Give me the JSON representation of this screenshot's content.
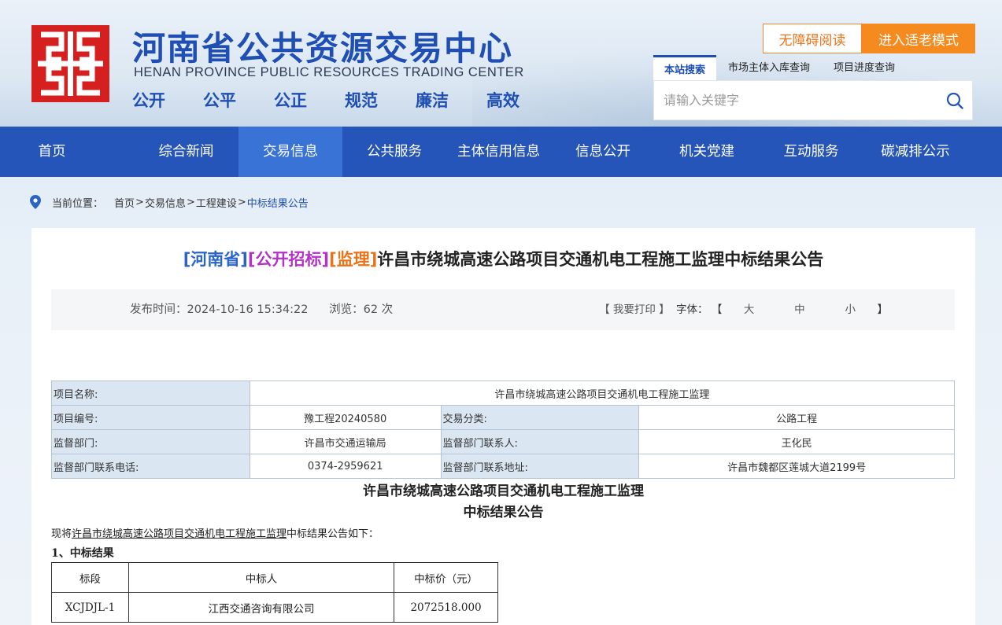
{
  "header": {
    "title_cn": "河南省公共资源交易中心",
    "title_en": "HENAN PROVINCE PUBLIC RESOURCES TRADING CENTER",
    "slogans": [
      "公开",
      "公平",
      "公正",
      "规范",
      "廉洁",
      "高效"
    ],
    "accessibility_label": "无障碍阅读",
    "elder_mode_label": "进入适老模式",
    "search_tabs": [
      "本站搜索",
      "市场主体入库查询",
      "项目进度查询"
    ],
    "search_placeholder": "请输入关键字",
    "brand_color": "#2555b8",
    "accent_color": "#f58a1f"
  },
  "nav": {
    "items": [
      "首页",
      "综合新闻",
      "交易信息",
      "公共服务",
      "主体信用信息",
      "信息公开",
      "机关党建",
      "互动服务",
      "碳减排公示"
    ],
    "active_index": 2
  },
  "breadcrumb": {
    "label": "当前位置：",
    "items": [
      "首页",
      "交易信息",
      "工程建设",
      "中标结果公告"
    ],
    "separator": ">"
  },
  "article": {
    "tag_region": "[河南省]",
    "tag_method": "[公开招标]",
    "tag_type": "[监理]",
    "title": "许昌市绕城高速公路项目交通机电工程施工监理中标结果公告",
    "publish_label": "发布时间：",
    "publish_time": "2024-10-16 15:34:22",
    "views_label": "浏览：",
    "views": "62 次",
    "print_label": "【 我要打印 】",
    "font_label": "字体：",
    "bracket_open": "【",
    "bracket_close": "】",
    "font_sizes": [
      "大",
      "中",
      "小"
    ]
  },
  "info_table": {
    "project_name_label": "项目名称:",
    "project_name": "许昌市绕城高速公路项目交通机电工程施工监理",
    "project_code_label": "项目编号:",
    "project_code": "豫工程20240580",
    "category_label": "交易分类:",
    "category": "公路工程",
    "supervisor_label": "监督部门:",
    "supervisor": "许昌市交通运输局",
    "contact_label": "监督部门联系人:",
    "contact": "王化民",
    "phone_label": "监督部门联系电话:",
    "phone": "0374-2959621",
    "address_label": "监督部门联系地址:",
    "address": "许昌市魏都区莲城大道2199号"
  },
  "doc": {
    "title_line1": "许昌市绕城高速公路项目交通机电工程施工监理",
    "title_line2": "中标结果公告",
    "intro_prefix": "现将",
    "intro_link": "许昌市绕城高速公路项目交通机电工程施工监理",
    "intro_suffix": "中标结果公告如下：",
    "section1": "1、中标结果",
    "result_headers": [
      "标段",
      "中标人",
      "中标价（元）"
    ],
    "result_rows": [
      [
        "XCJDJL-1",
        "江西交通咨询有限公司",
        "2072518.000"
      ]
    ]
  }
}
